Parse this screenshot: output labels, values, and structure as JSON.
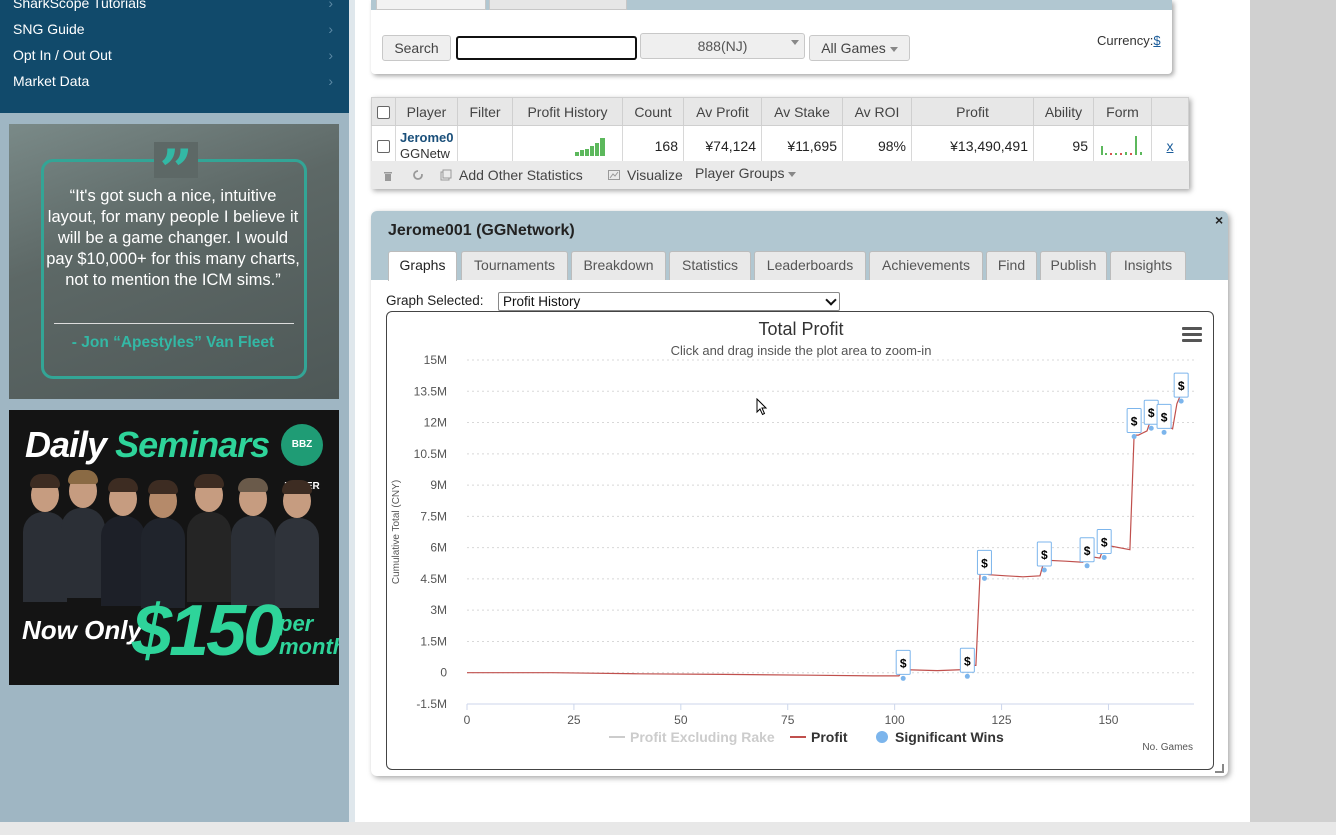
{
  "sidebar": {
    "menu": [
      {
        "label": "SharkScope Tutorials"
      },
      {
        "label": "SNG Guide"
      },
      {
        "label": "Opt In / Out Out"
      },
      {
        "label": "Market Data"
      }
    ],
    "chevron": "›",
    "ad_quote": {
      "text": "“It's got such a nice, intuitive layout, for many people I believe it will be a game changer. I would pay $10,000+ for this many charts, not to mention the ICM sims.”",
      "author": "- Jon “Apestyles” Van Fleet"
    },
    "ad_seminar": {
      "title_white": "Daily",
      "title_green": "Seminars",
      "logo": "BBZ POKER",
      "now_only": "Now Only",
      "price": "$150",
      "per_month": "per month"
    }
  },
  "search": {
    "search_button": "Search",
    "search_value": "",
    "network": "888(NJ)",
    "games": "All Games",
    "currency_label": "Currency:",
    "currency_value": "$"
  },
  "results": {
    "headers": [
      "Player",
      "Filter",
      "Profit History",
      "Count",
      "Av Profit",
      "Av Stake",
      "Av ROI",
      "Profit",
      "Ability",
      "Form"
    ],
    "row": {
      "player_name": "Jerome0",
      "network": "GGNetw",
      "count": "168",
      "av_profit": "¥74,124",
      "av_stake": "¥11,695",
      "av_roi": "98%",
      "profit": "¥13,490,491",
      "ability": "95",
      "remove": "x"
    },
    "toolbar": {
      "add_stats": "Add Other Statistics",
      "visualize": "Visualize",
      "player_groups": "Player Groups"
    }
  },
  "player_panel": {
    "title": "Jerome001 (GGNetwork)",
    "close": "×",
    "tabs": [
      "Graphs",
      "Tournaments",
      "Breakdown",
      "Statistics",
      "Leaderboards",
      "Achievements",
      "Find",
      "Publish",
      "Insights"
    ],
    "active_tab": "Graphs",
    "graph_label": "Graph Selected:",
    "graph_selected": "Profit History"
  },
  "chart_data": {
    "type": "line",
    "title": "Total Profit",
    "subtitle": "Click and drag inside the plot area to zoom-in",
    "ylabel": "Cumulative Total (CNY)",
    "xlabel": "No. Games",
    "x_ticks": [
      0,
      25,
      50,
      75,
      100,
      125,
      150
    ],
    "y_ticks": [
      "15M",
      "13.5M",
      "12M",
      "10.5M",
      "9M",
      "7.5M",
      "6M",
      "4.5M",
      "3M",
      "1.5M",
      "0",
      "-1.5M"
    ],
    "xlim": [
      0,
      170
    ],
    "ylim": [
      -1500000,
      15000000
    ],
    "grid": true,
    "legend_position": "bottom",
    "legend": [
      {
        "name": "Profit Excluding Rake",
        "color": "#cccccc",
        "type": "line",
        "dimmed": true
      },
      {
        "name": "Profit",
        "color": "#c0504d",
        "type": "line"
      },
      {
        "name": "Significant Wins",
        "color": "#7cb5ec",
        "type": "point"
      }
    ],
    "series": [
      {
        "name": "Profit",
        "color": "#c0504d",
        "x": [
          0,
          20,
          40,
          60,
          80,
          95,
          101,
          102,
          110,
          116,
          117,
          119,
          120,
          121,
          122,
          126,
          130,
          134,
          135,
          140,
          144,
          145,
          148,
          149,
          150,
          155,
          156,
          157,
          159,
          160,
          161,
          162,
          163,
          164,
          165,
          166,
          167,
          168
        ],
        "y": [
          0,
          0,
          -50000,
          -80000,
          -120000,
          -150000,
          -150000,
          150000,
          100000,
          150000,
          350000,
          350000,
          4900000,
          4800000,
          4700000,
          4650000,
          4600000,
          4650000,
          5400000,
          5350000,
          5300000,
          5600000,
          5500000,
          6100000,
          6100000,
          5900000,
          11400000,
          11400000,
          11600000,
          12200000,
          12100000,
          11900000,
          12200000,
          11800000,
          11700000,
          12900000,
          13400000,
          13490491
        ]
      }
    ],
    "significant_wins": [
      {
        "x": 102,
        "y": 400000
      },
      {
        "x": 117,
        "y": 500000
      },
      {
        "x": 121,
        "y": 5200000
      },
      {
        "x": 135,
        "y": 5600000
      },
      {
        "x": 145,
        "y": 5800000
      },
      {
        "x": 149,
        "y": 6200000
      },
      {
        "x": 156,
        "y": 12000000
      },
      {
        "x": 160,
        "y": 12400000
      },
      {
        "x": 163,
        "y": 12200000
      },
      {
        "x": 167,
        "y": 13700000
      }
    ],
    "significant_win_marker": "$"
  }
}
